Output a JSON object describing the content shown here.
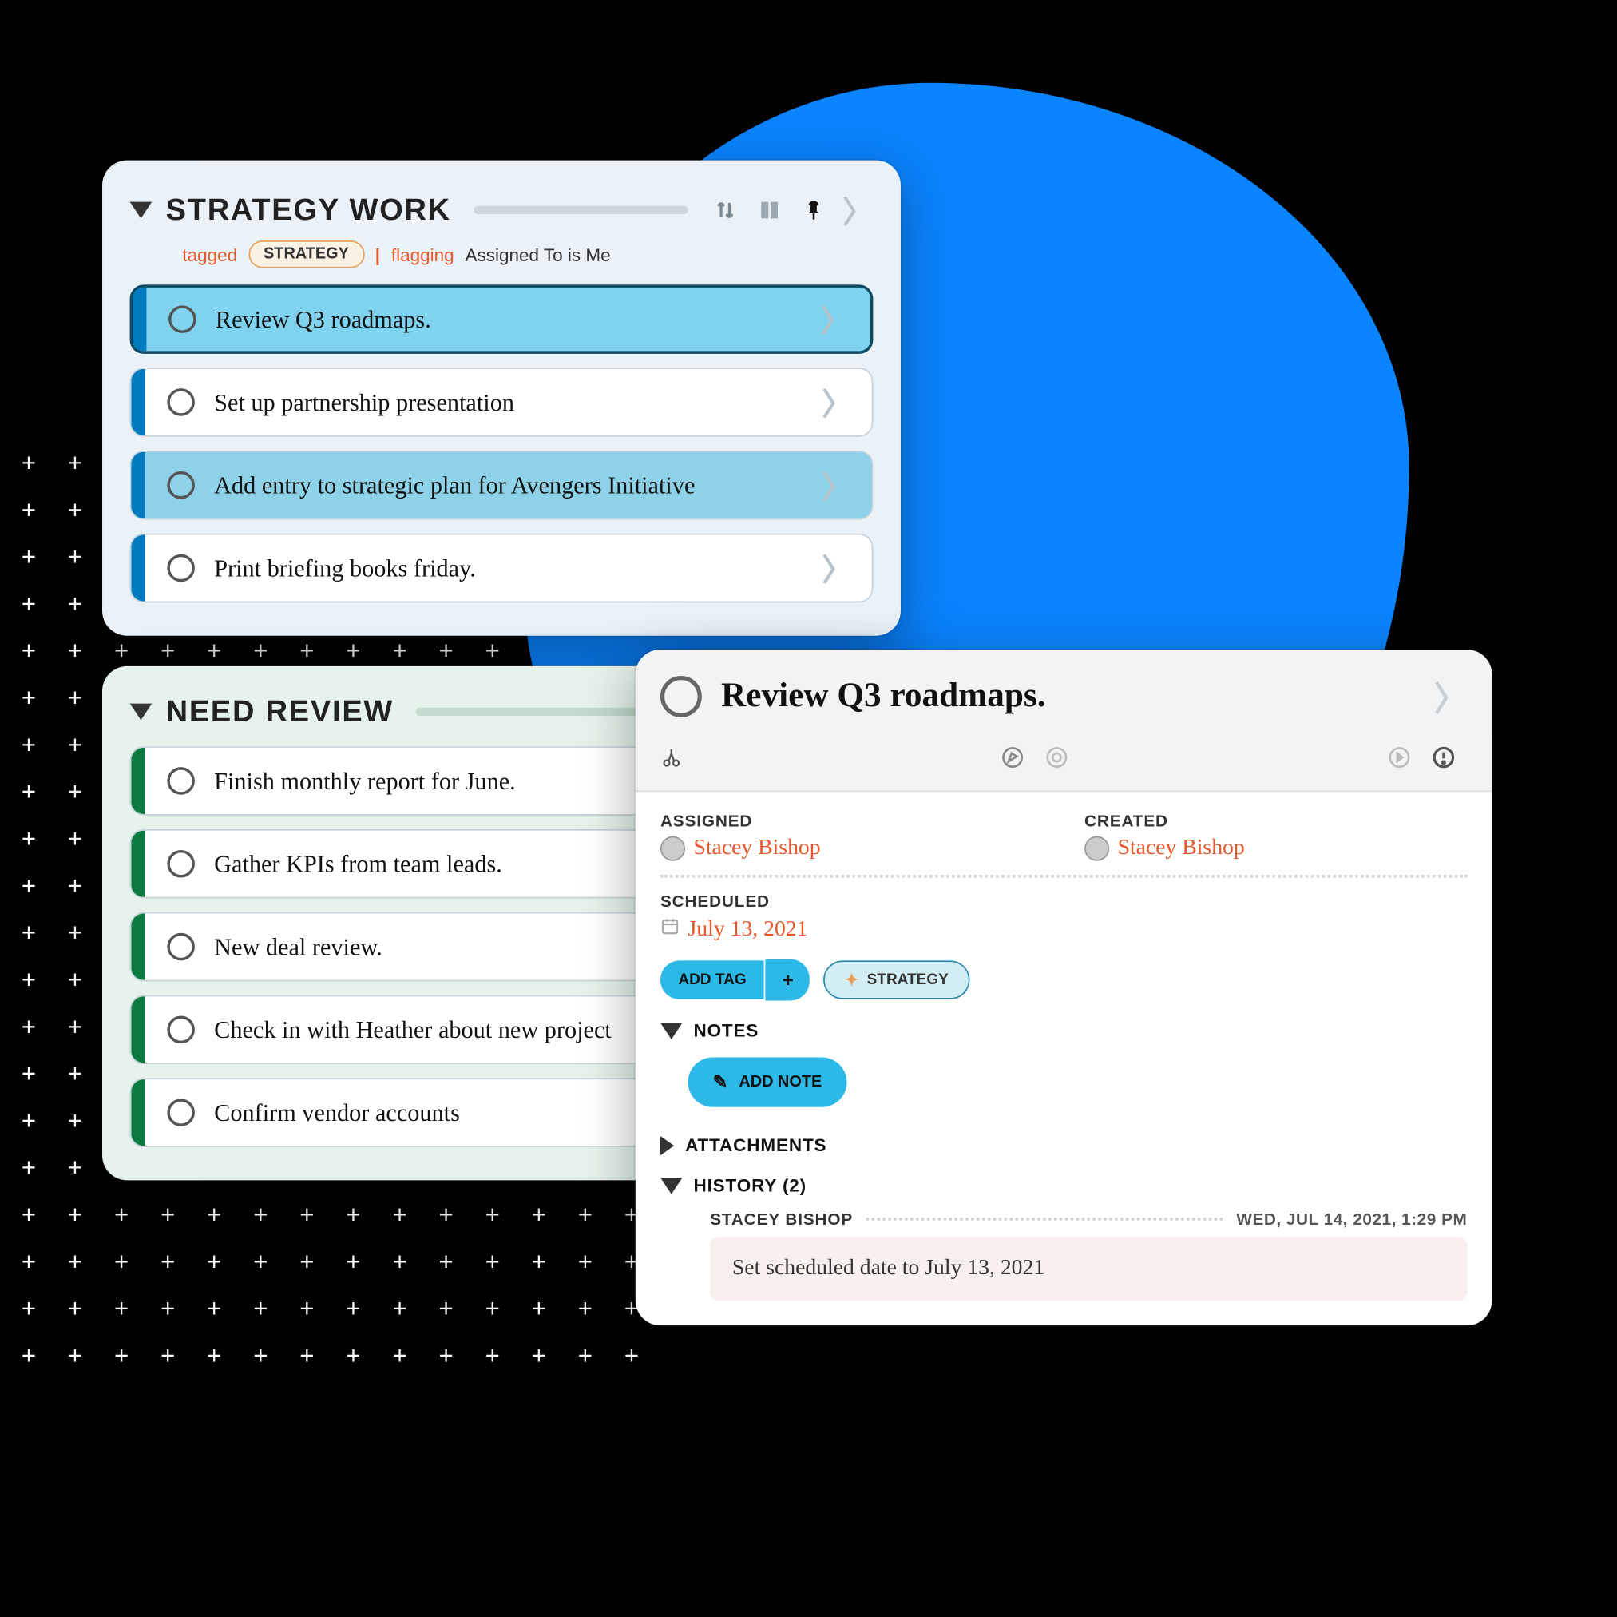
{
  "section1": {
    "title": "STRATEGY WORK",
    "sub_tagged": "tagged",
    "sub_tag": "STRATEGY",
    "sub_flagging": "flagging",
    "sub_flagtxt": "Assigned To is Me",
    "tasks": [
      "Review Q3 roadmaps.",
      "Set up partnership presentation",
      "Add entry to strategic plan for Avengers Initiative",
      "Print briefing books friday."
    ]
  },
  "section2": {
    "title": "NEED REVIEW",
    "tasks": [
      "Finish monthly report for June.",
      "Gather KPIs from team leads.",
      "New deal review.",
      "Check in with Heather about new project",
      "Confirm vendor accounts"
    ]
  },
  "detail": {
    "title": "Review Q3 roadmaps.",
    "assigned_lbl": "ASSIGNED",
    "assigned_val": "Stacey Bishop",
    "created_lbl": "CREATED",
    "created_val": "Stacey Bishop",
    "scheduled_lbl": "SCHEDULED",
    "scheduled_val": "July 13, 2021",
    "addtag_lbl": "ADD TAG",
    "plus_lbl": "+",
    "tag_val": "STRATEGY",
    "notes_lbl": "NOTES",
    "addnote_lbl": "ADD NOTE",
    "attach_lbl": "ATTACHMENTS",
    "history_lbl": "HISTORY (2)",
    "hist_name": "STACEY BISHOP",
    "hist_time": "WED, JUL 14, 2021, 1:29 PM",
    "hist_body": "Set scheduled date to July 13, 2021"
  }
}
